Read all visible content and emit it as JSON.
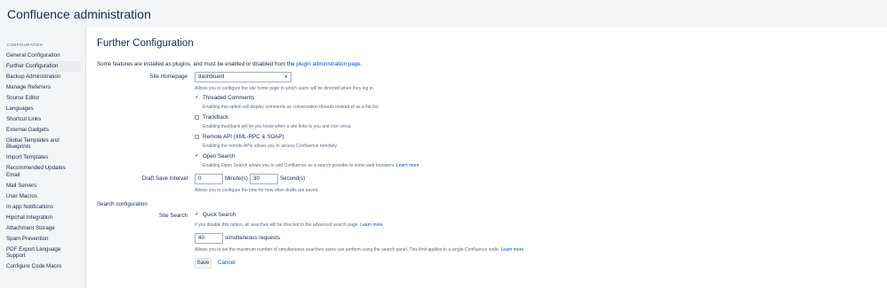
{
  "header": {
    "title": "Confluence administration"
  },
  "sidebar": {
    "heading": "CONFIGURATION",
    "items": [
      {
        "label": "General Configuration"
      },
      {
        "label": "Further Configuration",
        "active": true
      },
      {
        "label": "Backup Administration"
      },
      {
        "label": "Manage Referrers"
      },
      {
        "label": "Source Editor"
      },
      {
        "label": "Languages"
      },
      {
        "label": "Shortcut Links"
      },
      {
        "label": "External Gadgets"
      },
      {
        "label": "Global Templates and Blueprints"
      },
      {
        "label": "Import Templates"
      },
      {
        "label": "Recommended Updates Email"
      },
      {
        "label": "Mail Servers"
      },
      {
        "label": "User Macros"
      },
      {
        "label": "In-app Notifications"
      },
      {
        "label": "Hipchat Integration"
      },
      {
        "label": "Attachment Storage"
      },
      {
        "label": "Spam Prevention"
      },
      {
        "label": "PDF Export Language Support"
      },
      {
        "label": "Configure Code Macro"
      }
    ]
  },
  "main": {
    "title": "Further Configuration",
    "intro_text": "Some features are installed as plugins, and must be enabled or disabled from the",
    "intro_link": "plugin administration page",
    "intro_end": ".",
    "site_homepage": {
      "label": "Site Homepage",
      "value": "dashboard",
      "desc": "Allows you to configure the site home page to which users will be directed when they log in."
    },
    "threaded_comments": {
      "label": "Threaded Comments",
      "checked": true,
      "desc": "Enabling this option will display comments as conversation threads instead of as a flat list."
    },
    "trackback": {
      "label": "TrackBack",
      "checked": false,
      "desc": "Enabling trackback will let you know when a site links to you and vice versa."
    },
    "remote_api": {
      "label": "Remote API (XML-RPC & SOAP)",
      "checked": false,
      "desc": "Enabling the remote APIs allows you to access Confluence remotely."
    },
    "open_search": {
      "label": "Open Search",
      "checked": true,
      "desc": "Enabling Open Search allows you to add Confluence as a search provider to some web browsers.",
      "link": "Learn more"
    },
    "draft_save": {
      "label": "Draft Save Interval",
      "minutes": "0",
      "minutes_unit": "Minute(s)",
      "seconds": "30",
      "seconds_unit": "Second(s)",
      "desc": "Allows you to configure the time for how often drafts are saved."
    },
    "search_heading": "Search configuration",
    "site_search": {
      "label": "Site Search",
      "quick_label": "Quick Search",
      "checked": true,
      "desc": "If you disable this option, all searches will be directed to the advanced search page.",
      "link": "Learn more"
    },
    "simultaneous": {
      "value": "40",
      "unit": "simultaneous requests",
      "desc": "Allows you to set the maximum number of simultaneous searches users can perform using the search panel. This limit applies to a single Confluence node.",
      "link": "Learn more"
    },
    "save_label": "Save",
    "cancel_label": "Cancel"
  }
}
